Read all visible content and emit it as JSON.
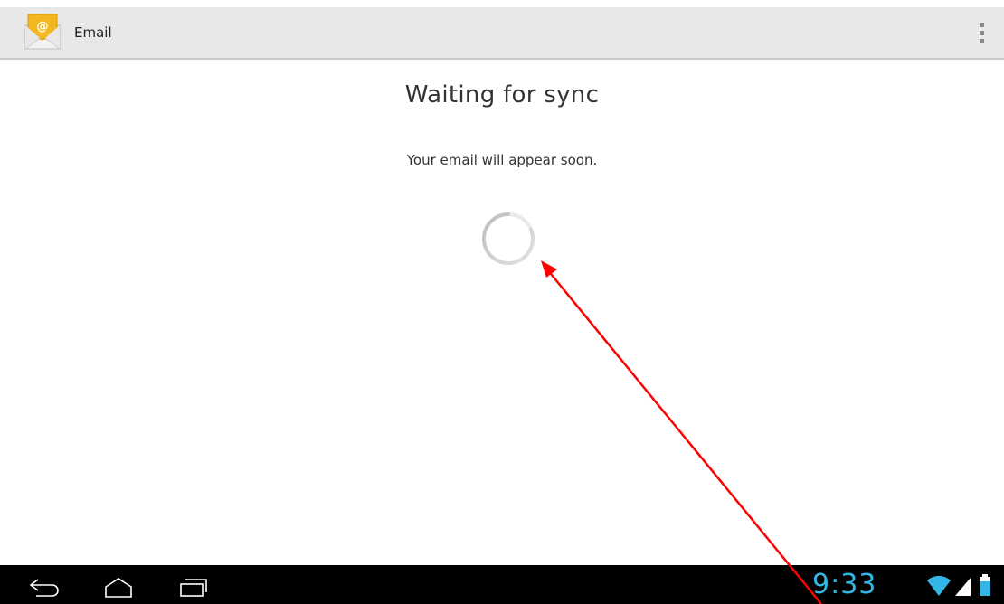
{
  "app": {
    "title": "Email",
    "icon": "email-envelope-icon",
    "menu_icon": "overflow-menu-icon"
  },
  "content": {
    "title": "Waiting for sync",
    "message": "Your email will appear soon.",
    "indicator": "progress-spinner"
  },
  "system_bar": {
    "time": "9:33",
    "nav": [
      "back-icon",
      "home-icon",
      "recent-apps-icon"
    ],
    "status": [
      "wifi-icon",
      "signal-icon",
      "battery-icon"
    ]
  },
  "colors": {
    "accent": "#33b5e5",
    "action_bar": "#e6e6e6",
    "system_bar": "#000000",
    "annotation_arrow": "#ff0000"
  }
}
